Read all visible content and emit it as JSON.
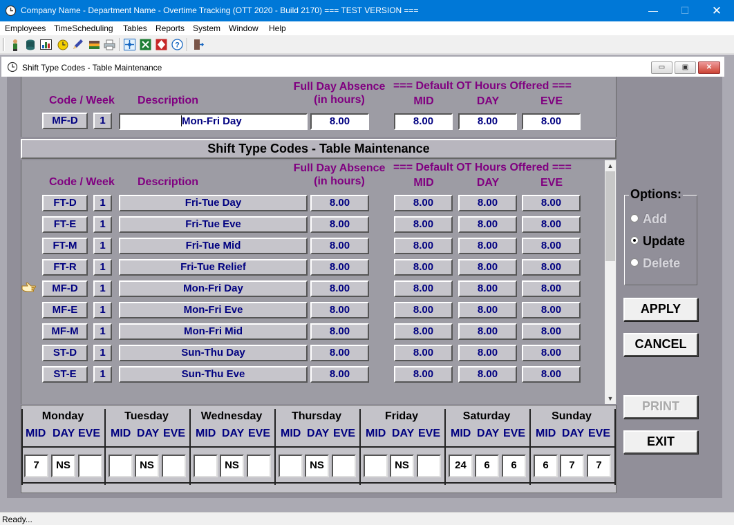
{
  "window": {
    "title": "Company Name - Department Name - Overtime Tracking (OTT 2020 - Build 2170) === TEST VERSION ===",
    "minimize": "—",
    "maximize": "☐",
    "close": "✕"
  },
  "menu": [
    "Employees",
    "TimeScheduling",
    "Tables",
    "Reports",
    "System",
    "Window",
    "Help"
  ],
  "toolbar": {
    "icons": [
      "employee-icon",
      "database-icon",
      "chart-icon",
      "clock-icon",
      "pencil-icon",
      "books-icon",
      "printer-icon",
      "network-icon",
      "excel-icon",
      "flowchart-icon",
      "help-icon",
      "exit-door-icon"
    ]
  },
  "child_window": {
    "title": "Shift Type Codes - Table Maintenance",
    "buttons": [
      "▭",
      "▣",
      "✕"
    ]
  },
  "headers": {
    "code_week": "Code / Week",
    "description": "Description",
    "full_day_absence": "Full Day Absence",
    "in_hours": "(in hours)",
    "default_ot": "=== Default OT Hours Offered ===",
    "mid": "MID",
    "day": "DAY",
    "eve": "EVE"
  },
  "edit_record": {
    "code": "MF-D",
    "week": "1",
    "description": "Mon-Fri Day",
    "absence": "8.00",
    "mid": "8.00",
    "day": "8.00",
    "eve": "8.00"
  },
  "section_title": "Shift Type Codes - Table Maintenance",
  "rows": [
    {
      "code": "FT-D",
      "week": "1",
      "description": "Fri-Tue Day",
      "absence": "8.00",
      "mid": "8.00",
      "day": "8.00",
      "eve": "8.00"
    },
    {
      "code": "FT-E",
      "week": "1",
      "description": "Fri-Tue Eve",
      "absence": "8.00",
      "mid": "8.00",
      "day": "8.00",
      "eve": "8.00"
    },
    {
      "code": "FT-M",
      "week": "1",
      "description": "Fri-Tue Mid",
      "absence": "8.00",
      "mid": "8.00",
      "day": "8.00",
      "eve": "8.00"
    },
    {
      "code": "FT-R",
      "week": "1",
      "description": "Fri-Tue Relief",
      "absence": "8.00",
      "mid": "8.00",
      "day": "8.00",
      "eve": "8.00"
    },
    {
      "code": "MF-D",
      "week": "1",
      "description": "Mon-Fri Day",
      "absence": "8.00",
      "mid": "8.00",
      "day": "8.00",
      "eve": "8.00"
    },
    {
      "code": "MF-E",
      "week": "1",
      "description": "Mon-Fri Eve",
      "absence": "8.00",
      "mid": "8.00",
      "day": "8.00",
      "eve": "8.00"
    },
    {
      "code": "MF-M",
      "week": "1",
      "description": "Mon-Fri Mid",
      "absence": "8.00",
      "mid": "8.00",
      "day": "8.00",
      "eve": "8.00"
    },
    {
      "code": "ST-D",
      "week": "1",
      "description": "Sun-Thu Day",
      "absence": "8.00",
      "mid": "8.00",
      "day": "8.00",
      "eve": "8.00"
    },
    {
      "code": "ST-E",
      "week": "1",
      "description": "Sun-Thu Eve",
      "absence": "8.00",
      "mid": "8.00",
      "day": "8.00",
      "eve": "8.00"
    }
  ],
  "selected_row": 4,
  "days": [
    {
      "name": "Monday",
      "mid": "7",
      "day": "NS",
      "eve": ""
    },
    {
      "name": "Tuesday",
      "mid": "",
      "day": "NS",
      "eve": ""
    },
    {
      "name": "Wednesday",
      "mid": "",
      "day": "NS",
      "eve": ""
    },
    {
      "name": "Thursday",
      "mid": "",
      "day": "NS",
      "eve": ""
    },
    {
      "name": "Friday",
      "mid": "",
      "day": "NS",
      "eve": ""
    },
    {
      "name": "Saturday",
      "mid": "24",
      "day": "6",
      "eve": "6"
    },
    {
      "name": "Sunday",
      "mid": "6",
      "day": "7",
      "eve": "7"
    }
  ],
  "options": {
    "title": "Options:",
    "add": "Add",
    "update": "Update",
    "delete": "Delete",
    "selected": "update"
  },
  "buttons": {
    "apply": "APPLY",
    "cancel": "CANCEL",
    "print": "PRINT",
    "exit": "EXIT"
  },
  "status": "Ready...",
  "colors": {
    "titlebar": "#0078d7",
    "header_text": "#800080",
    "field_text": "#000080",
    "panel": "#9d9ca4"
  }
}
